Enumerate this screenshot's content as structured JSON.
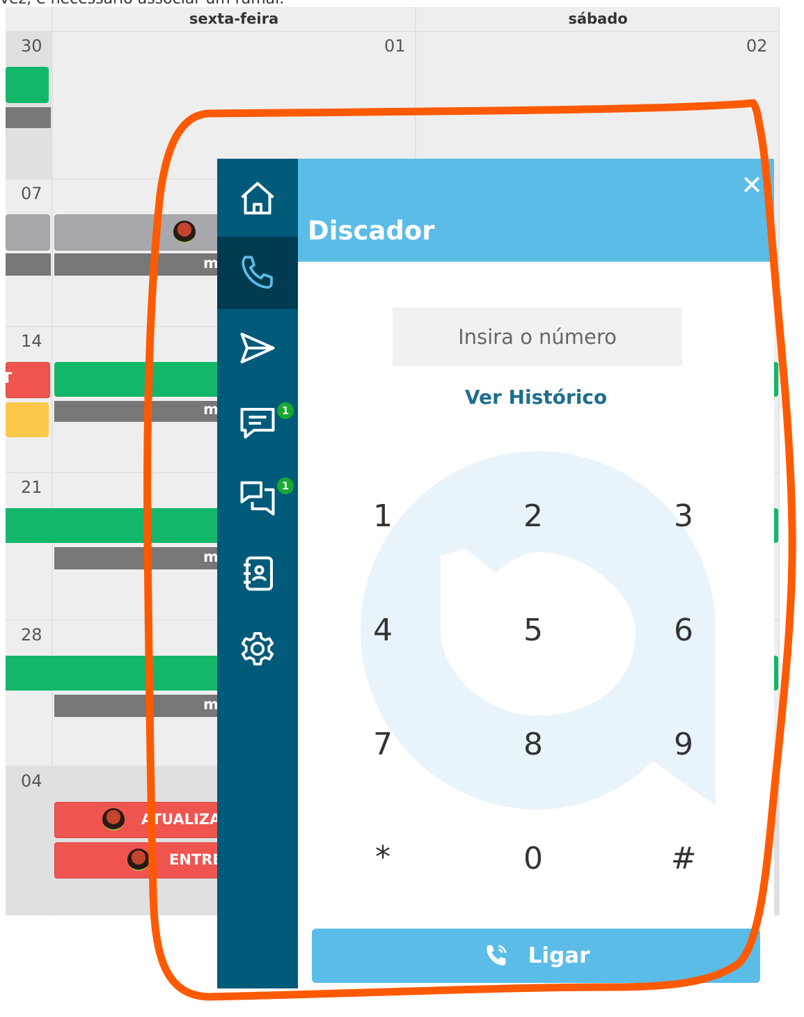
{
  "top_note": "vez, é necessário associar um ramal.",
  "calendar": {
    "headers": [
      "sexta-feira",
      "sábado"
    ],
    "rows": [
      {
        "week_start": "30",
        "friday": "01",
        "saturday": "02"
      },
      {
        "week_start": "07"
      },
      {
        "week_start": "14"
      },
      {
        "week_start": "21"
      },
      {
        "week_start": "28"
      },
      {
        "week_start": "04"
      }
    ],
    "event_labels": {
      "truncated_m": "m",
      "truncated_t": "T",
      "atualiza": "ATUALIZA",
      "entre": "ENTRE"
    }
  },
  "sidebar": {
    "items": [
      {
        "icon": "home-icon"
      },
      {
        "icon": "phone-icon",
        "active": true
      },
      {
        "icon": "send-icon"
      },
      {
        "icon": "message-icon",
        "badge": "1"
      },
      {
        "icon": "chat-icon",
        "badge": "1"
      },
      {
        "icon": "contacts-icon"
      },
      {
        "icon": "gear-icon"
      }
    ]
  },
  "dialer": {
    "title": "Discador",
    "close_label": "✕",
    "input_placeholder": "Insira o número",
    "history_link": "Ver Histórico",
    "keys": [
      "1",
      "2",
      "3",
      "4",
      "5",
      "6",
      "7",
      "8",
      "9",
      "*",
      "0",
      "#"
    ],
    "call_label": "Ligar"
  },
  "colors": {
    "sidebar": "#005a7a",
    "sidebar_active": "#003b52",
    "header": "#5bbce7",
    "badge": "#17a830",
    "annotation": "#ff5a00"
  }
}
